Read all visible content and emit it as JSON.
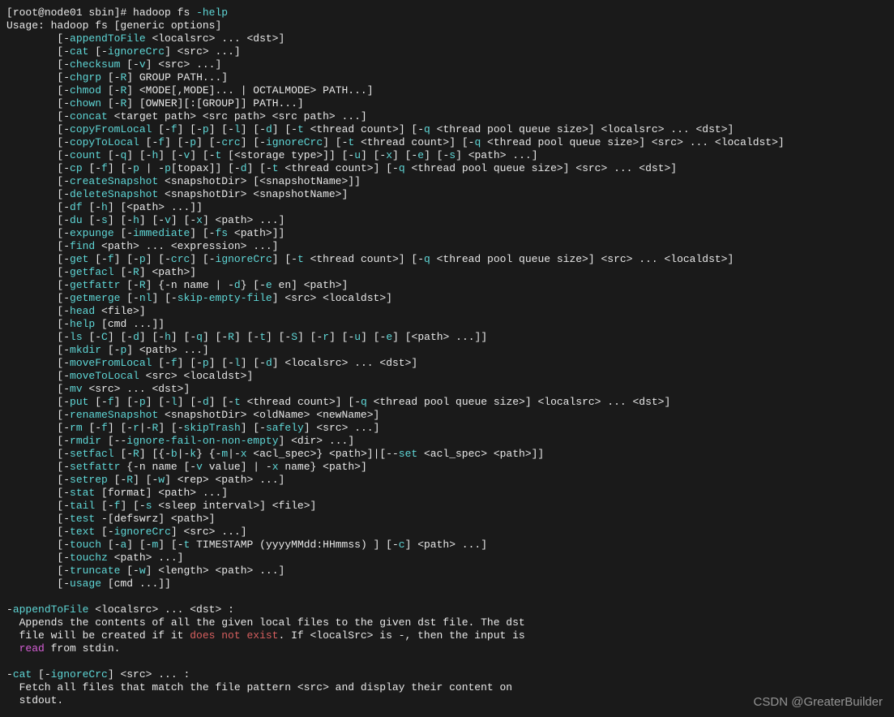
{
  "watermark": "CSDN @GreaterBuilder",
  "prompt": {
    "open": "[",
    "userhost": "root@node01 sbin",
    "close": "]# ",
    "cmd": "hadoop fs ",
    "flag": "-help"
  },
  "usage": "Usage: hadoop fs [generic options]",
  "indent": "        ",
  "lines": [
    [
      [
        "[-",
        0
      ],
      [
        "appendToFile",
        1
      ],
      [
        " <localsrc> ... <dst>]",
        0
      ]
    ],
    [
      [
        "[-",
        0
      ],
      [
        "cat",
        1
      ],
      [
        " [-",
        0
      ],
      [
        "ignoreCrc",
        1
      ],
      [
        "] <src> ...]",
        0
      ]
    ],
    [
      [
        "[-",
        0
      ],
      [
        "checksum",
        1
      ],
      [
        " [-",
        0
      ],
      [
        "v",
        1
      ],
      [
        "] <src> ...]",
        0
      ]
    ],
    [
      [
        "[-",
        0
      ],
      [
        "chgrp",
        1
      ],
      [
        " [-",
        0
      ],
      [
        "R",
        1
      ],
      [
        "] GROUP PATH...]",
        0
      ]
    ],
    [
      [
        "[-",
        0
      ],
      [
        "chmod",
        1
      ],
      [
        " [-",
        0
      ],
      [
        "R",
        1
      ],
      [
        "] <MODE[,MODE]... | OCTALMODE> PATH...]",
        0
      ]
    ],
    [
      [
        "[-",
        0
      ],
      [
        "chown",
        1
      ],
      [
        " [-",
        0
      ],
      [
        "R",
        1
      ],
      [
        "] [OWNER][:[GROUP]] PATH...]",
        0
      ]
    ],
    [
      [
        "[-",
        0
      ],
      [
        "concat",
        1
      ],
      [
        " <target path> <src path> <src path> ...]",
        0
      ]
    ],
    [
      [
        "[-",
        0
      ],
      [
        "copyFromLocal",
        1
      ],
      [
        " [-",
        0
      ],
      [
        "f",
        1
      ],
      [
        "] [-",
        0
      ],
      [
        "p",
        1
      ],
      [
        "] [-",
        0
      ],
      [
        "l",
        1
      ],
      [
        "] [-",
        0
      ],
      [
        "d",
        1
      ],
      [
        "] [-",
        0
      ],
      [
        "t",
        1
      ],
      [
        " <thread count>] [-",
        0
      ],
      [
        "q",
        1
      ],
      [
        " <thread pool queue size>] <localsrc> ... <dst>]",
        0
      ]
    ],
    [
      [
        "[-",
        0
      ],
      [
        "copyToLocal",
        1
      ],
      [
        " [-",
        0
      ],
      [
        "f",
        1
      ],
      [
        "] [-",
        0
      ],
      [
        "p",
        1
      ],
      [
        "] [-",
        0
      ],
      [
        "crc",
        1
      ],
      [
        "] [-",
        0
      ],
      [
        "ignoreCrc",
        1
      ],
      [
        "] [-",
        0
      ],
      [
        "t",
        1
      ],
      [
        " <thread count>] [-",
        0
      ],
      [
        "q",
        1
      ],
      [
        " <thread pool queue size>] <src> ... <localdst>]",
        0
      ]
    ],
    [
      [
        "[-",
        0
      ],
      [
        "count",
        1
      ],
      [
        " [-",
        0
      ],
      [
        "q",
        1
      ],
      [
        "] [-",
        0
      ],
      [
        "h",
        1
      ],
      [
        "] [-",
        0
      ],
      [
        "v",
        1
      ],
      [
        "] [-",
        0
      ],
      [
        "t",
        1
      ],
      [
        " [<storage type>]] [-",
        0
      ],
      [
        "u",
        1
      ],
      [
        "] [-",
        0
      ],
      [
        "x",
        1
      ],
      [
        "] [-",
        0
      ],
      [
        "e",
        1
      ],
      [
        "] [-",
        0
      ],
      [
        "s",
        1
      ],
      [
        "] <path> ...]",
        0
      ]
    ],
    [
      [
        "[-",
        0
      ],
      [
        "cp",
        1
      ],
      [
        " [-",
        0
      ],
      [
        "f",
        1
      ],
      [
        "] [-",
        0
      ],
      [
        "p",
        1
      ],
      [
        " | -",
        0
      ],
      [
        "p",
        1
      ],
      [
        "[topax]] [-",
        0
      ],
      [
        "d",
        1
      ],
      [
        "] [-",
        0
      ],
      [
        "t",
        1
      ],
      [
        " <thread count>] [-",
        0
      ],
      [
        "q",
        1
      ],
      [
        " <thread pool queue size>] <src> ... <dst>]",
        0
      ]
    ],
    [
      [
        "[-",
        0
      ],
      [
        "createSnapshot",
        1
      ],
      [
        " <snapshotDir> [<snapshotName>]]",
        0
      ]
    ],
    [
      [
        "[-",
        0
      ],
      [
        "deleteSnapshot",
        1
      ],
      [
        " <snapshotDir> <snapshotName>]",
        0
      ]
    ],
    [
      [
        "[-",
        0
      ],
      [
        "df",
        1
      ],
      [
        " [-",
        0
      ],
      [
        "h",
        1
      ],
      [
        "] [<path> ...]]",
        0
      ]
    ],
    [
      [
        "[-",
        0
      ],
      [
        "du",
        1
      ],
      [
        " [-",
        0
      ],
      [
        "s",
        1
      ],
      [
        "] [-",
        0
      ],
      [
        "h",
        1
      ],
      [
        "] [-",
        0
      ],
      [
        "v",
        1
      ],
      [
        "] [-",
        0
      ],
      [
        "x",
        1
      ],
      [
        "] <path> ...]",
        0
      ]
    ],
    [
      [
        "[-",
        0
      ],
      [
        "expunge",
        1
      ],
      [
        " [-",
        0
      ],
      [
        "immediate",
        1
      ],
      [
        "] [-",
        0
      ],
      [
        "fs",
        1
      ],
      [
        " <path>]]",
        0
      ]
    ],
    [
      [
        "[-",
        0
      ],
      [
        "find",
        1
      ],
      [
        " <path> ... <expression> ...]",
        0
      ]
    ],
    [
      [
        "[-",
        0
      ],
      [
        "get",
        1
      ],
      [
        " [-",
        0
      ],
      [
        "f",
        1
      ],
      [
        "] [-",
        0
      ],
      [
        "p",
        1
      ],
      [
        "] [-",
        0
      ],
      [
        "crc",
        1
      ],
      [
        "] [-",
        0
      ],
      [
        "ignoreCrc",
        1
      ],
      [
        "] [-",
        0
      ],
      [
        "t",
        1
      ],
      [
        " <thread count>] [-",
        0
      ],
      [
        "q",
        1
      ],
      [
        " <thread pool queue size>] <src> ... <localdst>]",
        0
      ]
    ],
    [
      [
        "[-",
        0
      ],
      [
        "getfacl",
        1
      ],
      [
        " [-",
        0
      ],
      [
        "R",
        1
      ],
      [
        "] <path>]",
        0
      ]
    ],
    [
      [
        "[-",
        0
      ],
      [
        "getfattr",
        1
      ],
      [
        " [-",
        0
      ],
      [
        "R",
        1
      ],
      [
        "] {-n name | -",
        0
      ],
      [
        "d",
        1
      ],
      [
        "} [-",
        0
      ],
      [
        "e",
        1
      ],
      [
        " en] <path>]",
        0
      ]
    ],
    [
      [
        "[-",
        0
      ],
      [
        "getmerge",
        1
      ],
      [
        " [-",
        0
      ],
      [
        "nl",
        1
      ],
      [
        "] [-",
        0
      ],
      [
        "skip-empty-file",
        1
      ],
      [
        "] <src> <localdst>]",
        0
      ]
    ],
    [
      [
        "[-",
        0
      ],
      [
        "head",
        1
      ],
      [
        " <file>]",
        0
      ]
    ],
    [
      [
        "[-",
        0
      ],
      [
        "help",
        1
      ],
      [
        " [cmd ...]]",
        0
      ]
    ],
    [
      [
        "[-",
        0
      ],
      [
        "ls",
        1
      ],
      [
        " [-",
        0
      ],
      [
        "C",
        1
      ],
      [
        "] [-",
        0
      ],
      [
        "d",
        1
      ],
      [
        "] [-",
        0
      ],
      [
        "h",
        1
      ],
      [
        "] [-",
        0
      ],
      [
        "q",
        1
      ],
      [
        "] [-",
        0
      ],
      [
        "R",
        1
      ],
      [
        "] [-",
        0
      ],
      [
        "t",
        1
      ],
      [
        "] [-",
        0
      ],
      [
        "S",
        1
      ],
      [
        "] [-",
        0
      ],
      [
        "r",
        1
      ],
      [
        "] [-",
        0
      ],
      [
        "u",
        1
      ],
      [
        "] [-",
        0
      ],
      [
        "e",
        1
      ],
      [
        "] [<path> ...]]",
        0
      ]
    ],
    [
      [
        "[-",
        0
      ],
      [
        "mkdir",
        1
      ],
      [
        " [-",
        0
      ],
      [
        "p",
        1
      ],
      [
        "] <path> ...]",
        0
      ]
    ],
    [
      [
        "[-",
        0
      ],
      [
        "moveFromLocal",
        1
      ],
      [
        " [-",
        0
      ],
      [
        "f",
        1
      ],
      [
        "] [-",
        0
      ],
      [
        "p",
        1
      ],
      [
        "] [-",
        0
      ],
      [
        "l",
        1
      ],
      [
        "] [-",
        0
      ],
      [
        "d",
        1
      ],
      [
        "] <localsrc> ... <dst>]",
        0
      ]
    ],
    [
      [
        "[-",
        0
      ],
      [
        "moveToLocal",
        1
      ],
      [
        " <src> <localdst>]",
        0
      ]
    ],
    [
      [
        "[-",
        0
      ],
      [
        "mv",
        1
      ],
      [
        " <src> ... <dst>]",
        0
      ]
    ],
    [
      [
        "[-",
        0
      ],
      [
        "put",
        1
      ],
      [
        " [-",
        0
      ],
      [
        "f",
        1
      ],
      [
        "] [-",
        0
      ],
      [
        "p",
        1
      ],
      [
        "] [-",
        0
      ],
      [
        "l",
        1
      ],
      [
        "] [-",
        0
      ],
      [
        "d",
        1
      ],
      [
        "] [-",
        0
      ],
      [
        "t",
        1
      ],
      [
        " <thread count>] [-",
        0
      ],
      [
        "q",
        1
      ],
      [
        " <thread pool queue size>] <localsrc> ... <dst>]",
        0
      ]
    ],
    [
      [
        "[-",
        0
      ],
      [
        "renameSnapshot",
        1
      ],
      [
        " <snapshotDir> <oldName> <newName>]",
        0
      ]
    ],
    [
      [
        "[-",
        0
      ],
      [
        "rm",
        1
      ],
      [
        " [-",
        0
      ],
      [
        "f",
        1
      ],
      [
        "] [-",
        0
      ],
      [
        "r",
        1
      ],
      [
        "|-",
        0
      ],
      [
        "R",
        1
      ],
      [
        "] [-",
        0
      ],
      [
        "skipTrash",
        1
      ],
      [
        "] [-",
        0
      ],
      [
        "safely",
        1
      ],
      [
        "] <src> ...]",
        0
      ]
    ],
    [
      [
        "[-",
        0
      ],
      [
        "rmdir",
        1
      ],
      [
        " [--",
        0
      ],
      [
        "ignore-fail-on-non-empty",
        1
      ],
      [
        "] <dir> ...]",
        0
      ]
    ],
    [
      [
        "[-",
        0
      ],
      [
        "setfacl",
        1
      ],
      [
        " [-",
        0
      ],
      [
        "R",
        1
      ],
      [
        "] [{-",
        0
      ],
      [
        "b",
        1
      ],
      [
        "|-",
        0
      ],
      [
        "k",
        1
      ],
      [
        "} {-",
        0
      ],
      [
        "m",
        1
      ],
      [
        "|-",
        0
      ],
      [
        "x",
        1
      ],
      [
        " <acl_spec>} <path>]|[--",
        0
      ],
      [
        "set",
        1
      ],
      [
        " <acl_spec> <path>]]",
        0
      ]
    ],
    [
      [
        "[-",
        0
      ],
      [
        "setfattr",
        1
      ],
      [
        " {-n name [-",
        0
      ],
      [
        "v",
        1
      ],
      [
        " value] | -",
        0
      ],
      [
        "x",
        1
      ],
      [
        " name} <path>]",
        0
      ]
    ],
    [
      [
        "[-",
        0
      ],
      [
        "setrep",
        1
      ],
      [
        " [-",
        0
      ],
      [
        "R",
        1
      ],
      [
        "] [-",
        0
      ],
      [
        "w",
        1
      ],
      [
        "] <rep> <path> ...]",
        0
      ]
    ],
    [
      [
        "[-",
        0
      ],
      [
        "stat",
        1
      ],
      [
        " [format] <path> ...]",
        0
      ]
    ],
    [
      [
        "[-",
        0
      ],
      [
        "tail",
        1
      ],
      [
        " [-",
        0
      ],
      [
        "f",
        1
      ],
      [
        "] [-",
        0
      ],
      [
        "s",
        1
      ],
      [
        " <sleep interval>] <file>]",
        0
      ]
    ],
    [
      [
        "[-",
        0
      ],
      [
        "test",
        1
      ],
      [
        " -[defswrz] <path>]",
        0
      ]
    ],
    [
      [
        "[-",
        0
      ],
      [
        "text",
        1
      ],
      [
        " [-",
        0
      ],
      [
        "ignoreCrc",
        1
      ],
      [
        "] <src> ...]",
        0
      ]
    ],
    [
      [
        "[-",
        0
      ],
      [
        "touch",
        1
      ],
      [
        " [-",
        0
      ],
      [
        "a",
        1
      ],
      [
        "] [-",
        0
      ],
      [
        "m",
        1
      ],
      [
        "] [-",
        0
      ],
      [
        "t",
        1
      ],
      [
        " TIMESTAMP (yyyyMMdd:HHmmss) ] [-",
        0
      ],
      [
        "c",
        1
      ],
      [
        "] <path> ...]",
        0
      ]
    ],
    [
      [
        "[-",
        0
      ],
      [
        "touchz",
        1
      ],
      [
        " <path> ...]",
        0
      ]
    ],
    [
      [
        "[-",
        0
      ],
      [
        "truncate",
        1
      ],
      [
        " [-",
        0
      ],
      [
        "w",
        1
      ],
      [
        "] <length> <path> ...]",
        0
      ]
    ],
    [
      [
        "[-",
        0
      ],
      [
        "usage",
        1
      ],
      [
        " [cmd ...]]",
        0
      ]
    ]
  ],
  "desc": {
    "appendToFile": {
      "head": [
        [
          "-",
          0
        ],
        [
          "appendToFile",
          1
        ],
        [
          " <localsrc> ... <dst> :",
          0
        ]
      ],
      "body": [
        [
          [
            "  Appends the contents of all the given local files to the given dst file. The dst",
            0
          ]
        ],
        [
          [
            "  file will be created if it ",
            0
          ],
          [
            "does not exist",
            2
          ],
          [
            ". If <localSrc> is -, then the input is",
            0
          ]
        ],
        [
          [
            "  ",
            0
          ],
          [
            "read",
            3
          ],
          [
            " from stdin.",
            0
          ]
        ]
      ]
    },
    "cat": {
      "head": [
        [
          "-",
          0
        ],
        [
          "cat",
          1
        ],
        [
          " [-",
          0
        ],
        [
          "ignoreCrc",
          1
        ],
        [
          "] <src> ... :",
          0
        ]
      ],
      "body": [
        [
          [
            "  Fetch all files that match the file pattern <src> and display their content on",
            0
          ]
        ],
        [
          [
            "  stdout.",
            0
          ]
        ]
      ]
    }
  }
}
